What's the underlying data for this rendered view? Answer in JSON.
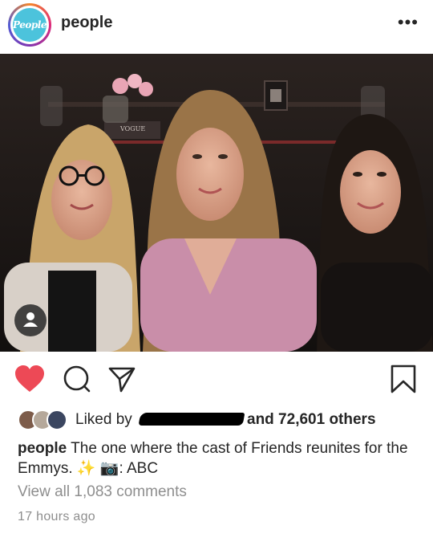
{
  "account": {
    "username": "people",
    "logo_text": "People",
    "more_icon": "more-horizontal-icon"
  },
  "post": {
    "image_text": "VOGUE",
    "liked": true,
    "likes_prefix": "Liked by",
    "likes_suffix": "and 72,601 others",
    "caption_user": "people",
    "caption_text": "The one where the cast of Friends reunites for the Emmys. ✨ 📷: ABC",
    "view_comments": "View all 1,083 comments",
    "timestamp": "17 hours ago"
  },
  "colors": {
    "like_red": "#ed4956",
    "secondary_text": "#8e8e8e",
    "logo_blue": "#4cc3dc"
  }
}
